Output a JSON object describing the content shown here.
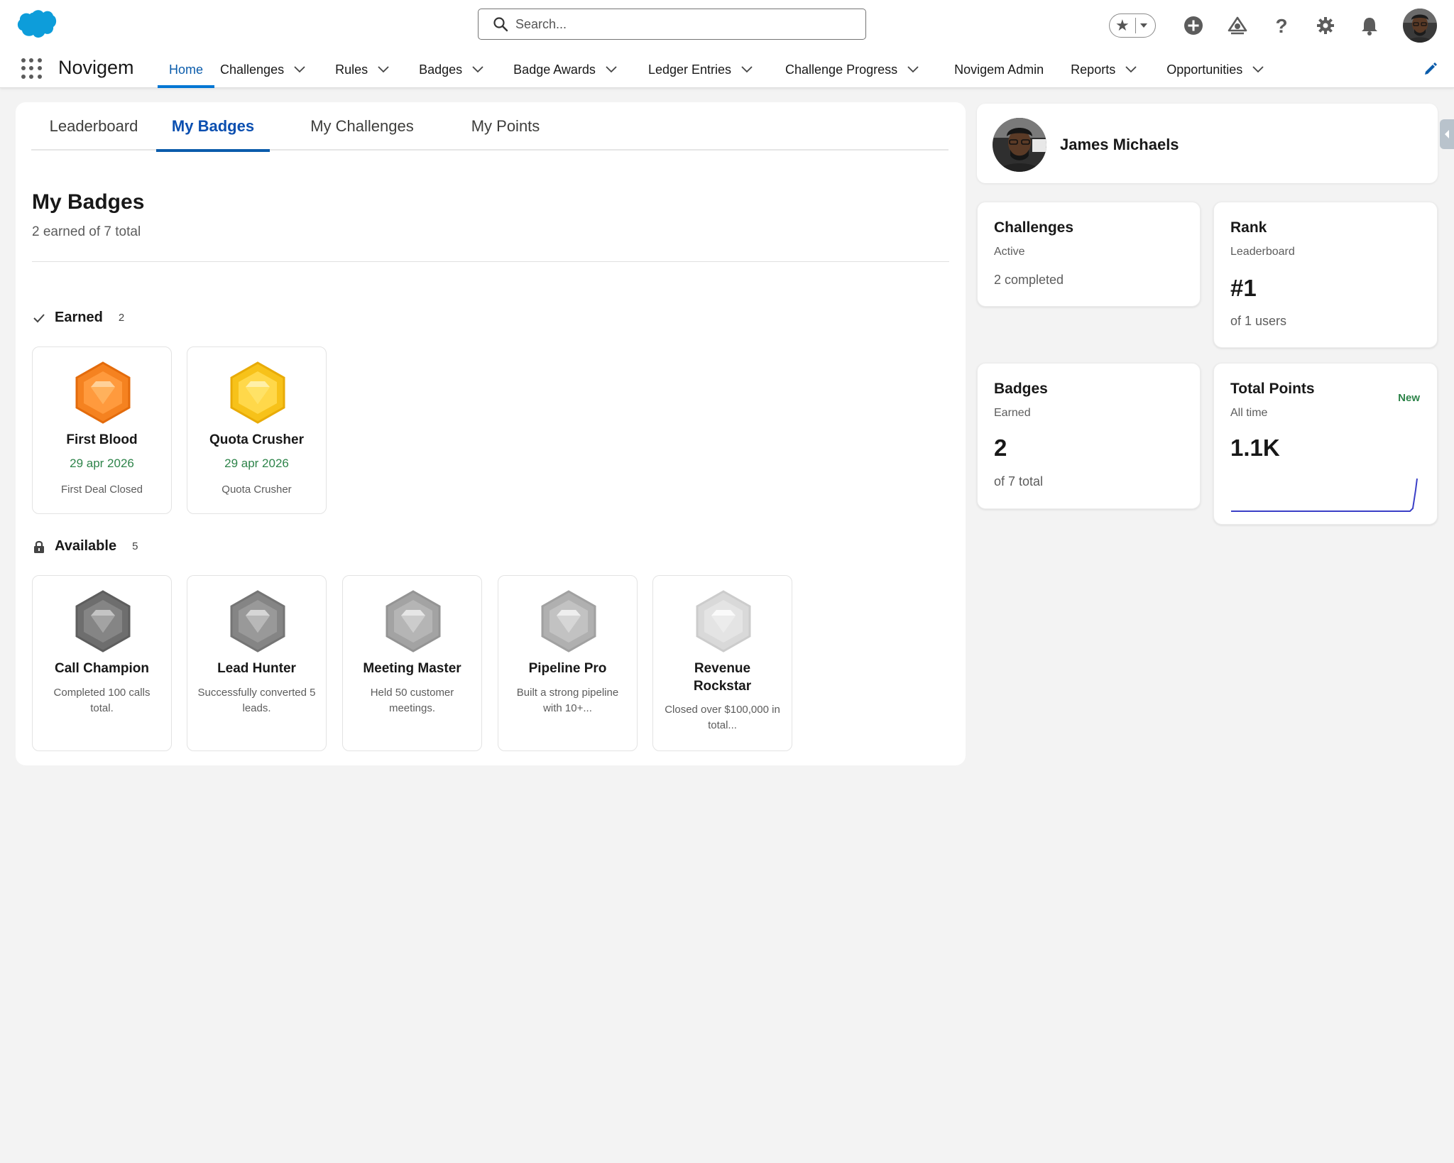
{
  "header": {
    "search_placeholder": "Search...",
    "app_name": "Novigem",
    "nav": [
      {
        "label": "Home",
        "active": true,
        "dropdown": false
      },
      {
        "label": "Challenges",
        "dropdown": true
      },
      {
        "label": "Rules",
        "dropdown": true
      },
      {
        "label": "Badges",
        "dropdown": true
      },
      {
        "label": "Badge Awards",
        "dropdown": true
      },
      {
        "label": "Ledger Entries",
        "dropdown": true
      },
      {
        "label": "Challenge Progress",
        "dropdown": true
      },
      {
        "label": "Novigem Admin",
        "dropdown": false
      },
      {
        "label": "Reports",
        "dropdown": true
      },
      {
        "label": "Opportunities",
        "dropdown": true
      }
    ],
    "icons": [
      "favorites-star-icon",
      "global-actions-add-icon",
      "trailhead-icon",
      "help-icon",
      "setup-gear-icon",
      "notifications-bell-icon",
      "user-avatar"
    ]
  },
  "tabs": [
    "Leaderboard",
    "My Badges",
    "My Challenges",
    "My Points"
  ],
  "active_tab": "My Badges",
  "badges_section": {
    "title": "My Badges",
    "subtitle": "2 earned of 7 total",
    "earned": {
      "label": "Earned",
      "count": "2",
      "items": [
        {
          "name": "First Blood",
          "date": "29 apr 2026",
          "desc": "First Deal Closed",
          "color": "#f58220"
        },
        {
          "name": "Quota Crusher",
          "date": "29 apr 2026",
          "desc": "Quota Crusher",
          "color": "#f7c21a"
        }
      ]
    },
    "available": {
      "label": "Available",
      "count": "5",
      "items": [
        {
          "name": "Call Champion",
          "desc": "Completed 100 calls total.",
          "color": "#7a7a7a"
        },
        {
          "name": "Lead Hunter",
          "desc": "Successfully converted 5 leads.",
          "color": "#8c8c8c"
        },
        {
          "name": "Meeting Master",
          "desc": "Held 50 customer meetings.",
          "color": "#a6a6a6"
        },
        {
          "name": "Pipeline Pro",
          "desc": "Built a strong pipeline with 10+...",
          "color": "#b3b3b3"
        },
        {
          "name": "Revenue Rockstar",
          "desc": "Closed over $100,000 in total...",
          "color": "#d6d6d6"
        }
      ]
    }
  },
  "profile": {
    "name": "James Michaels"
  },
  "stats": {
    "challenges": {
      "title": "Challenges",
      "sub": "Active",
      "foot": "2 completed"
    },
    "rank": {
      "title": "Rank",
      "sub": "Leaderboard",
      "value": "#1",
      "foot": "of 1 users"
    },
    "badges": {
      "title": "Badges",
      "sub": "Earned",
      "value": "2",
      "foot": "of 7 total"
    },
    "points": {
      "title": "Total Points",
      "sub": "All time",
      "value": "1.1K",
      "badge": "New",
      "sparkline_color": "#3b3fc7"
    }
  }
}
